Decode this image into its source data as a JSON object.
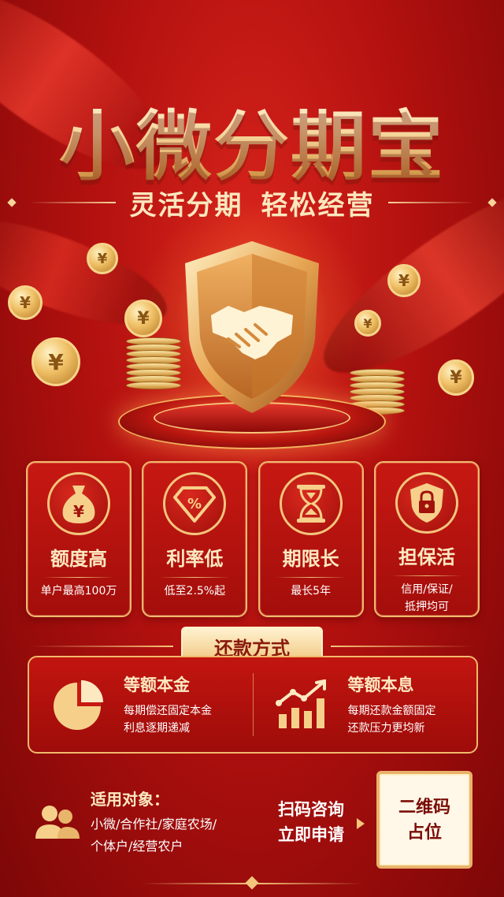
{
  "hero": {
    "title": "小微分期宝",
    "subtitle": "灵活分期  轻松经营"
  },
  "coin_symbol": "¥",
  "features": [
    {
      "icon": "money-bag-icon",
      "symbol": "¥",
      "title": "额度高",
      "desc": "单户最高100万"
    },
    {
      "icon": "percent-diamond-icon",
      "symbol": "%",
      "title": "利率低",
      "desc": "低至2.5%起"
    },
    {
      "icon": "hourglass-icon",
      "title": "期限长",
      "desc": "最长5年"
    },
    {
      "icon": "lock-shield-icon",
      "title": "担保活",
      "desc_line1": "信用/保证/",
      "desc_line2": "抵押均可"
    }
  ],
  "repayment": {
    "label": "还款方式",
    "methods": [
      {
        "icon": "pie-chart-icon",
        "title": "等额本金",
        "line1": "每期偿还固定本金",
        "line2": "利息逐期递减"
      },
      {
        "icon": "bar-growth-icon",
        "title": "等额本息",
        "line1": "每期还款金额固定",
        "line2": "还款压力更均新"
      }
    ]
  },
  "target": {
    "icon": "people-icon",
    "title": "适用对象：",
    "line1": "小微/合作社/家庭农场/",
    "line2": "个体户/经营农户"
  },
  "cta": {
    "line1": "扫码咨询",
    "line2": "立即申请"
  },
  "qr_placeholder": "二维码\n占位",
  "colors": {
    "background": "#b3110f",
    "gold": "#f4c67c",
    "card": "#c71812",
    "title_text": "#fde9c1"
  }
}
